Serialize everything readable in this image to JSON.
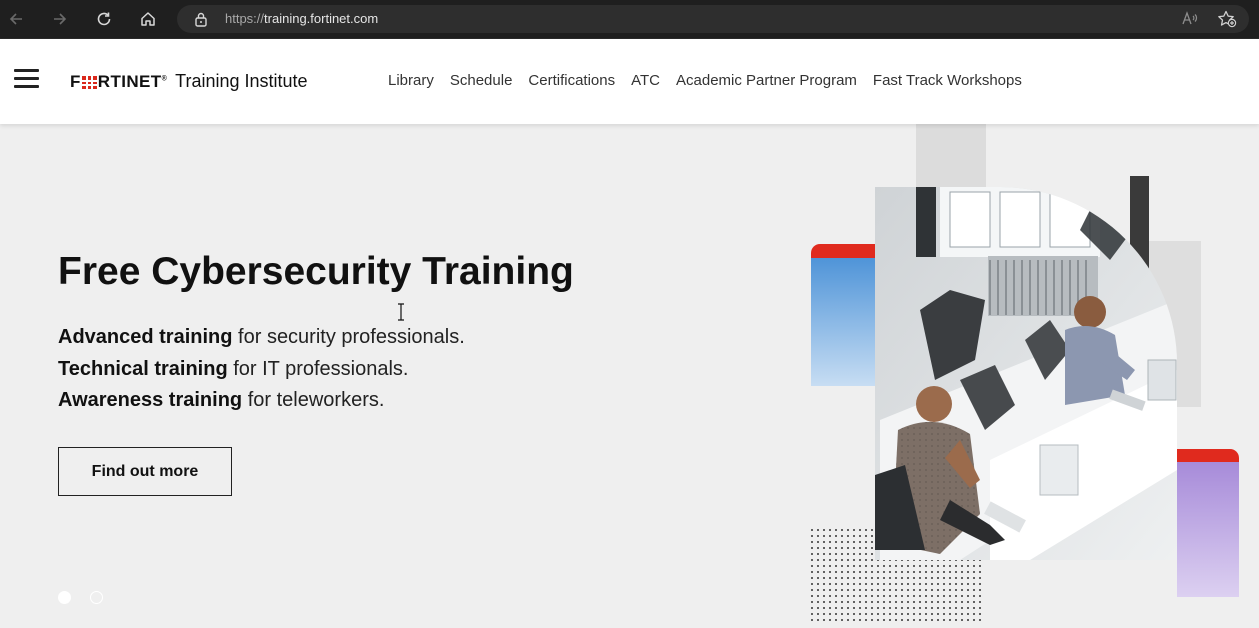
{
  "browser": {
    "url_scheme": "https://",
    "url_host": "training.fortinet.com",
    "back_icon": "arrow-left-icon",
    "forward_icon": "arrow-right-icon",
    "reload_icon": "reload-icon",
    "home_icon": "home-icon",
    "lock_icon": "lock-icon",
    "read_aloud_icon": "read-aloud-icon",
    "favorites_icon": "add-favorite-icon"
  },
  "header": {
    "menu_icon": "hamburger-menu-icon",
    "logo_text_pre": "F",
    "logo_text_post": "RTINET",
    "logo_mark": "®",
    "logo_subtitle": "Training Institute",
    "nav": [
      {
        "label": "Library"
      },
      {
        "label": "Schedule"
      },
      {
        "label": "Certifications"
      },
      {
        "label": "ATC"
      },
      {
        "label": "Academic Partner Program"
      },
      {
        "label": "Fast Track Workshops"
      }
    ]
  },
  "hero": {
    "title": "Free Cybersecurity Training",
    "lines": [
      {
        "bold": "Advanced training",
        "rest": " for security professionals."
      },
      {
        "bold": "Technical training",
        "rest": " for IT professionals."
      },
      {
        "bold": "Awareness training",
        "rest": " for teleworkers."
      }
    ],
    "cta_label": "Find out more",
    "slides": {
      "count": 2,
      "active": 1
    }
  },
  "colors": {
    "brand_red": "#da291c",
    "page_bg": "#efefef",
    "chrome_bg": "#1f1f1f",
    "accent_blue": "#5a9fdc",
    "accent_purple": "#b89be0"
  }
}
